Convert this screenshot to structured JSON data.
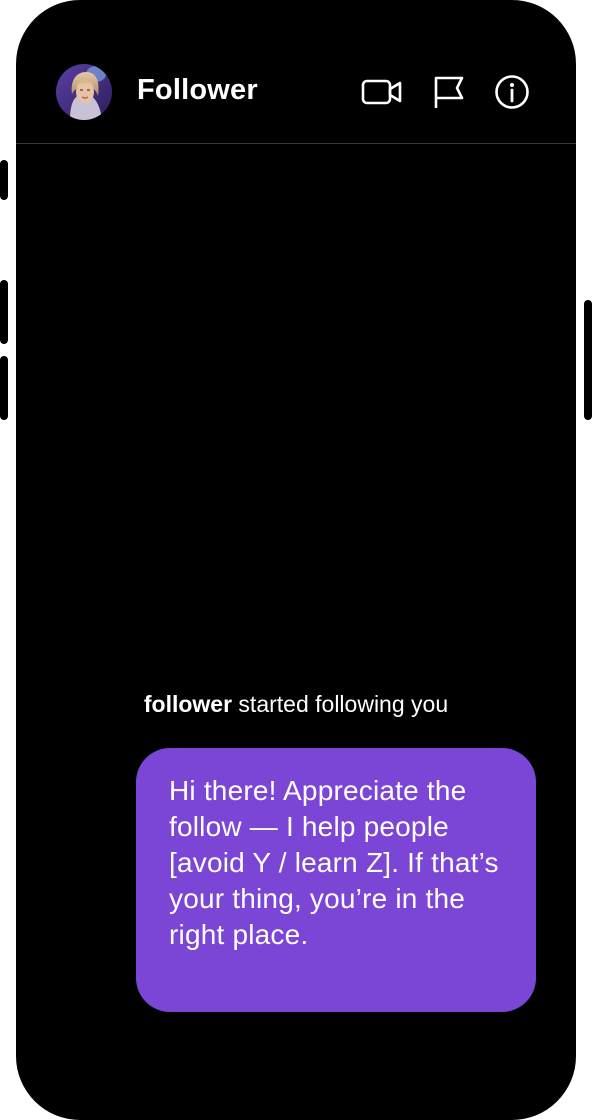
{
  "header": {
    "title": "Follower",
    "icons": [
      "video-call-icon",
      "flag-icon",
      "info-icon"
    ]
  },
  "conversation": {
    "system_message": {
      "username": "follower",
      "action_text": " started following you"
    },
    "messages": [
      {
        "sender": "me",
        "text": "Hi there! Appreciate the follow — I help people [avoid Y / learn Z]. If that’s your thing, you’re in the right place."
      }
    ]
  },
  "colors": {
    "background": "#000000",
    "bubble": "#7b45d6",
    "divider": "#3a3a3c",
    "text": "#ffffff"
  }
}
